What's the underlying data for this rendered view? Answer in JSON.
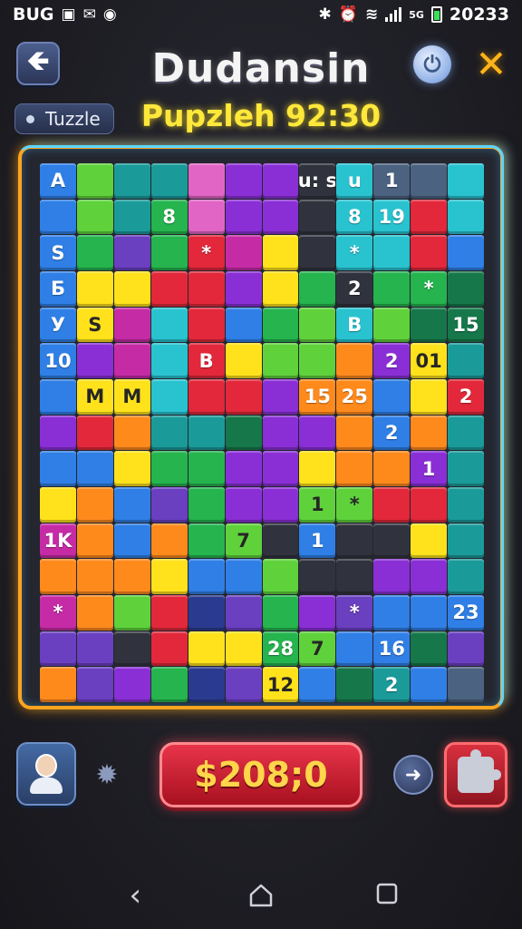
{
  "status_bar": {
    "left_text": "BUG",
    "time": "20233",
    "network": "5G"
  },
  "header": {
    "back_icon": "back-arrow-icon",
    "title": "Dudansin",
    "subtitle": "Pupzleh 92:30",
    "mode_label": "Tuzzle"
  },
  "board": {
    "colors": {
      "blue": "#2f7fe6",
      "lime": "#5fd23b",
      "green": "#25b44e",
      "darkgreen": "#16774a",
      "cyan": "#29c3d0",
      "teal": "#1a9b9a",
      "purple": "#8a2fd6",
      "violet": "#6a3fc0",
      "magenta": "#c62ba6",
      "pink": "#e065c4",
      "red": "#e2283a",
      "orange": "#ff8a1c",
      "yellow": "#ffe21b",
      "darkslate": "#30323d",
      "slate": "#4b6280",
      "navy": "#2a3b8f"
    },
    "rows": [
      [
        [
          "blue",
          "A"
        ],
        [
          "lime",
          ""
        ],
        [
          "teal",
          ""
        ],
        [
          "teal",
          ""
        ],
        [
          "pink",
          ""
        ],
        [
          "purple",
          ""
        ],
        [
          "purple",
          ""
        ],
        [
          "darkslate",
          "u: s"
        ],
        [
          "cyan",
          "u"
        ],
        [
          "slate",
          "1"
        ],
        [
          "slate",
          ""
        ],
        [
          "cyan",
          ""
        ]
      ],
      [
        [
          "blue",
          ""
        ],
        [
          "lime",
          ""
        ],
        [
          "teal",
          ""
        ],
        [
          "green",
          "8"
        ],
        [
          "pink",
          ""
        ],
        [
          "purple",
          ""
        ],
        [
          "purple",
          ""
        ],
        [
          "darkslate",
          ""
        ],
        [
          "cyan",
          "8"
        ],
        [
          "cyan",
          "19"
        ],
        [
          "red",
          ""
        ],
        [
          "cyan",
          ""
        ]
      ],
      [
        [
          "blue",
          "S"
        ],
        [
          "green",
          ""
        ],
        [
          "violet",
          ""
        ],
        [
          "green",
          ""
        ],
        [
          "red",
          "*"
        ],
        [
          "magenta",
          ""
        ],
        [
          "yellow",
          ""
        ],
        [
          "darkslate",
          ""
        ],
        [
          "cyan",
          "*"
        ],
        [
          "cyan",
          ""
        ],
        [
          "red",
          ""
        ],
        [
          "blue",
          ""
        ]
      ],
      [
        [
          "blue",
          "Б"
        ],
        [
          "yellow",
          ""
        ],
        [
          "yellow",
          ""
        ],
        [
          "red",
          ""
        ],
        [
          "red",
          ""
        ],
        [
          "purple",
          ""
        ],
        [
          "yellow",
          ""
        ],
        [
          "green",
          ""
        ],
        [
          "darkslate",
          "2"
        ],
        [
          "green",
          ""
        ],
        [
          "green",
          "*"
        ],
        [
          "darkgreen",
          ""
        ]
      ],
      [
        [
          "blue",
          "У"
        ],
        [
          "yellow",
          "S"
        ],
        [
          "magenta",
          ""
        ],
        [
          "cyan",
          ""
        ],
        [
          "red",
          ""
        ],
        [
          "blue",
          ""
        ],
        [
          "green",
          ""
        ],
        [
          "lime",
          ""
        ],
        [
          "cyan",
          "B"
        ],
        [
          "lime",
          ""
        ],
        [
          "darkgreen",
          ""
        ],
        [
          "darkgreen",
          "15"
        ]
      ],
      [
        [
          "blue",
          "10"
        ],
        [
          "purple",
          ""
        ],
        [
          "magenta",
          ""
        ],
        [
          "cyan",
          ""
        ],
        [
          "red",
          "B"
        ],
        [
          "yellow",
          ""
        ],
        [
          "lime",
          ""
        ],
        [
          "lime",
          ""
        ],
        [
          "orange",
          ""
        ],
        [
          "purple",
          "2"
        ],
        [
          "yellow",
          "01"
        ],
        [
          "teal",
          ""
        ]
      ],
      [
        [
          "blue",
          ""
        ],
        [
          "yellow",
          "M"
        ],
        [
          "yellow",
          "M"
        ],
        [
          "cyan",
          ""
        ],
        [
          "red",
          ""
        ],
        [
          "red",
          ""
        ],
        [
          "purple",
          ""
        ],
        [
          "orange",
          "15"
        ],
        [
          "orange",
          "25"
        ],
        [
          "blue",
          ""
        ],
        [
          "yellow",
          ""
        ],
        [
          "red",
          "2"
        ]
      ],
      [
        [
          "purple",
          ""
        ],
        [
          "red",
          ""
        ],
        [
          "orange",
          ""
        ],
        [
          "teal",
          ""
        ],
        [
          "teal",
          ""
        ],
        [
          "darkgreen",
          ""
        ],
        [
          "purple",
          ""
        ],
        [
          "purple",
          ""
        ],
        [
          "orange",
          ""
        ],
        [
          "blue",
          "2"
        ],
        [
          "orange",
          ""
        ],
        [
          "teal",
          ""
        ]
      ],
      [
        [
          "blue",
          ""
        ],
        [
          "blue",
          ""
        ],
        [
          "yellow",
          ""
        ],
        [
          "green",
          ""
        ],
        [
          "green",
          ""
        ],
        [
          "purple",
          ""
        ],
        [
          "purple",
          ""
        ],
        [
          "yellow",
          ""
        ],
        [
          "orange",
          ""
        ],
        [
          "orange",
          ""
        ],
        [
          "purple",
          "1"
        ],
        [
          "teal",
          ""
        ]
      ],
      [
        [
          "yellow",
          ""
        ],
        [
          "orange",
          ""
        ],
        [
          "blue",
          ""
        ],
        [
          "violet",
          ""
        ],
        [
          "green",
          ""
        ],
        [
          "purple",
          ""
        ],
        [
          "purple",
          ""
        ],
        [
          "lime",
          "1"
        ],
        [
          "lime",
          "*"
        ],
        [
          "red",
          ""
        ],
        [
          "red",
          ""
        ],
        [
          "teal",
          ""
        ]
      ],
      [
        [
          "magenta",
          "1K"
        ],
        [
          "orange",
          ""
        ],
        [
          "blue",
          ""
        ],
        [
          "orange",
          ""
        ],
        [
          "green",
          ""
        ],
        [
          "lime",
          "7"
        ],
        [
          "darkslate",
          ""
        ],
        [
          "blue",
          "1"
        ],
        [
          "darkslate",
          ""
        ],
        [
          "darkslate",
          ""
        ],
        [
          "yellow",
          ""
        ],
        [
          "teal",
          ""
        ]
      ],
      [
        [
          "orange",
          ""
        ],
        [
          "orange",
          ""
        ],
        [
          "orange",
          ""
        ],
        [
          "yellow",
          ""
        ],
        [
          "blue",
          ""
        ],
        [
          "blue",
          ""
        ],
        [
          "lime",
          ""
        ],
        [
          "darkslate",
          ""
        ],
        [
          "darkslate",
          ""
        ],
        [
          "purple",
          ""
        ],
        [
          "purple",
          ""
        ],
        [
          "teal",
          ""
        ]
      ],
      [
        [
          "magenta",
          "*"
        ],
        [
          "orange",
          ""
        ],
        [
          "lime",
          ""
        ],
        [
          "red",
          ""
        ],
        [
          "navy",
          ""
        ],
        [
          "violet",
          ""
        ],
        [
          "green",
          ""
        ],
        [
          "purple",
          ""
        ],
        [
          "violet",
          "*"
        ],
        [
          "blue",
          ""
        ],
        [
          "blue",
          ""
        ],
        [
          "blue",
          "23"
        ]
      ],
      [
        [
          "violet",
          ""
        ],
        [
          "violet",
          ""
        ],
        [
          "darkslate",
          ""
        ],
        [
          "red",
          ""
        ],
        [
          "yellow",
          ""
        ],
        [
          "yellow",
          ""
        ],
        [
          "green",
          "28"
        ],
        [
          "lime",
          "7"
        ],
        [
          "blue",
          ""
        ],
        [
          "blue",
          "16"
        ],
        [
          "darkgreen",
          ""
        ],
        [
          "violet",
          ""
        ]
      ],
      [
        [
          "orange",
          ""
        ],
        [
          "violet",
          ""
        ],
        [
          "purple",
          ""
        ],
        [
          "green",
          ""
        ],
        [
          "navy",
          ""
        ],
        [
          "violet",
          ""
        ],
        [
          "yellow",
          "12"
        ],
        [
          "blue",
          ""
        ],
        [
          "darkgreen",
          ""
        ],
        [
          "teal",
          "2"
        ],
        [
          "blue",
          ""
        ],
        [
          "slate",
          ""
        ]
      ]
    ]
  },
  "controls": {
    "avatar_icon": "user-avatar-icon",
    "settings_icon": "puzzle-gear-icon",
    "price_label": "$208;0",
    "next_icon": "arrow-right-icon",
    "puzzle_icon": "puzzle-piece-icon"
  },
  "nav": {
    "back": "‹"
  }
}
